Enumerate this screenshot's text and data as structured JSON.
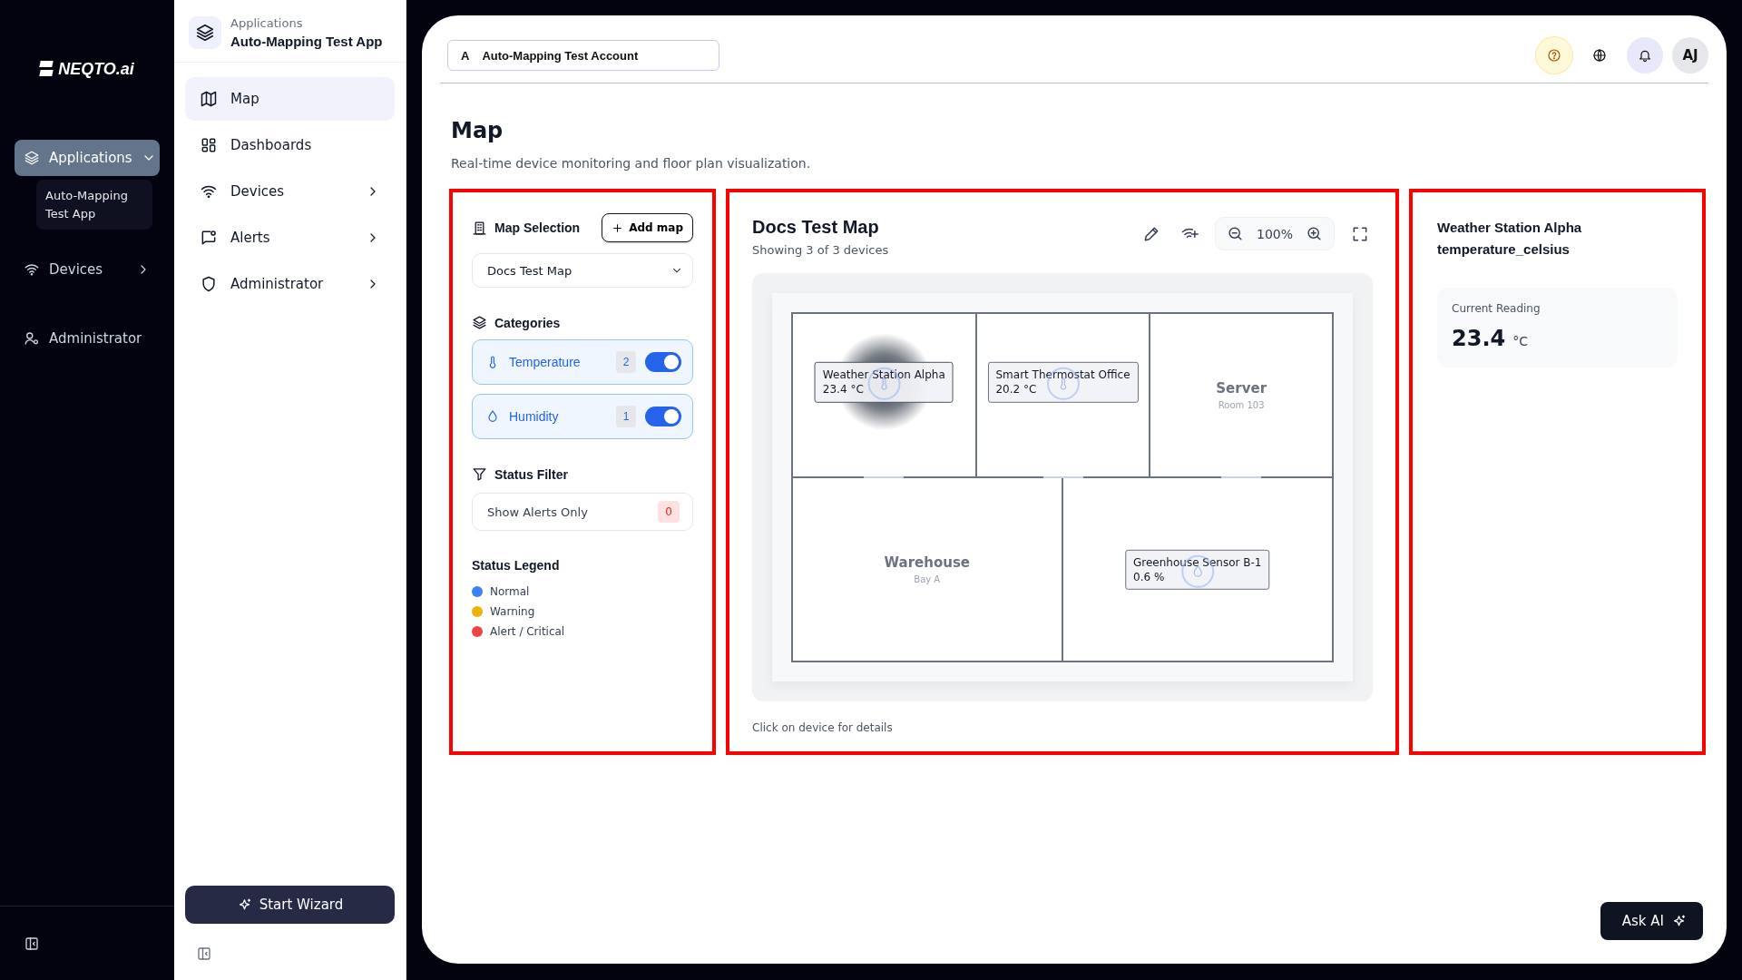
{
  "nav": {
    "logo": "NEQTO.ai",
    "items": [
      {
        "label": "Applications",
        "selected": true,
        "expanded": true,
        "children": [
          {
            "label": "Auto-Mapping Test App",
            "selected": true
          }
        ]
      },
      {
        "label": "Devices",
        "selected": false,
        "expanded": false
      },
      {
        "label": "Administrator",
        "selected": false
      }
    ]
  },
  "sidebar": {
    "context_label": "Applications",
    "app_name": "Auto-Mapping Test App",
    "items": [
      {
        "label": "Map",
        "selected": true,
        "submenu": false
      },
      {
        "label": "Dashboards",
        "selected": false,
        "submenu": false
      },
      {
        "label": "Devices",
        "selected": false,
        "submenu": true
      },
      {
        "label": "Alerts",
        "selected": false,
        "submenu": true
      },
      {
        "label": "Administrator",
        "selected": false,
        "submenu": true
      }
    ],
    "wizard_button": "Start Wizard"
  },
  "header": {
    "account_initial": "A",
    "account": "Auto-Mapping Test Account",
    "avatar": "AJ"
  },
  "page": {
    "title": "Map",
    "subtitle": "Real-time device monitoring and floor plan visualization."
  },
  "map_selection": {
    "highlighted": true,
    "title": "Map Selection",
    "add_button": "Add map",
    "selected_map": "Docs Test Map",
    "categories_title": "Categories",
    "categories": [
      {
        "label": "Temperature",
        "kind": "temperature",
        "count": "2",
        "on": true
      },
      {
        "label": "Humidity",
        "kind": "humidity",
        "count": "1",
        "on": true
      }
    ],
    "status_filter_title": "Status Filter",
    "alerts_only": {
      "label": "Show Alerts Only",
      "count": "0"
    },
    "legend_title": "Status Legend",
    "legend": [
      {
        "label": "Normal",
        "color": "#3b82f6"
      },
      {
        "label": "Warning",
        "color": "#eab308"
      },
      {
        "label": "Alert / Critical",
        "color": "#ef4444"
      }
    ]
  },
  "map_view": {
    "highlighted": true,
    "title": "Docs Test Map",
    "subtitle": "Showing 3 of 3 devices",
    "zoom": "100%",
    "rooms": [
      {
        "device": {
          "name": "Weather Station Alpha",
          "reading": "23.4 °C",
          "kind": "temperature",
          "selected": true
        }
      },
      {
        "device": {
          "name": "Smart Thermostat Office",
          "reading": "20.2 °C",
          "kind": "temperature",
          "selected": false
        }
      },
      {
        "name": "Server",
        "sub": "Room 103"
      },
      {
        "name": "Warehouse",
        "sub": "Bay A"
      },
      {
        "device": {
          "name": "Greenhouse Sensor B-1",
          "reading": "0.6 %",
          "kind": "humidity",
          "selected": false
        }
      }
    ],
    "footer": "Click on device for details"
  },
  "details": {
    "highlighted": true,
    "device": "Weather Station Alpha",
    "metric": "temperature_celsius",
    "reading_label": "Current Reading",
    "value": "23.4",
    "unit": "°C"
  },
  "ask_ai": "Ask AI"
}
